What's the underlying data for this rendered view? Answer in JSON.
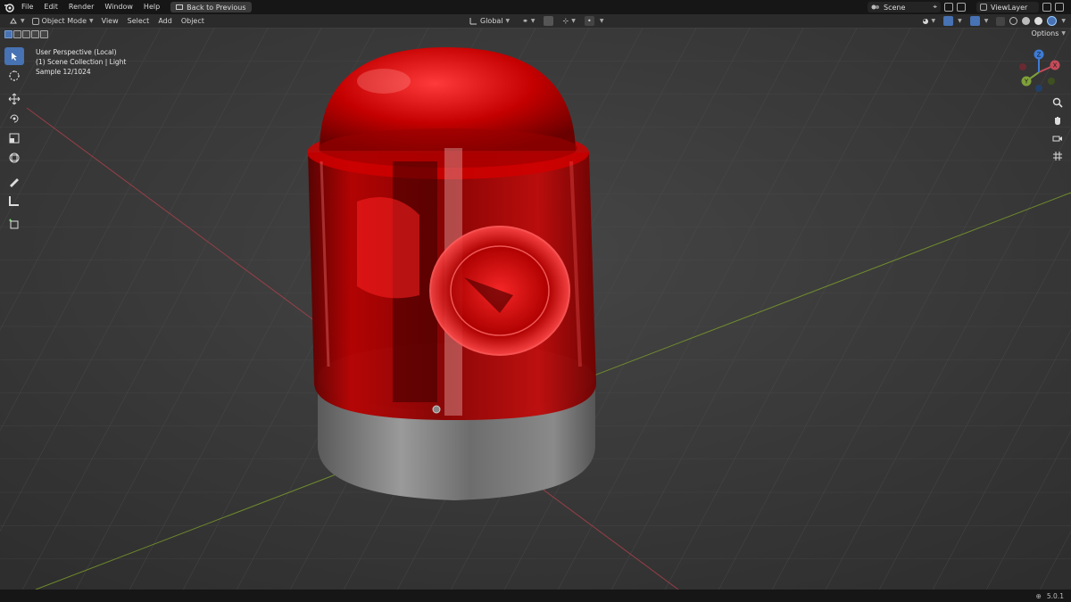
{
  "topbar": {
    "menus": [
      "File",
      "Edit",
      "Render",
      "Window",
      "Help"
    ],
    "back_button": "Back to Previous",
    "scene_name": "Scene",
    "view_layer": "ViewLayer"
  },
  "header": {
    "mode": "Object Mode",
    "menus": [
      "View",
      "Select",
      "Add",
      "Object"
    ],
    "orientation": "Global",
    "options": "Options"
  },
  "viewport": {
    "perspective": "User Perspective (Local)",
    "collection": "(1) Scene Collection | Light",
    "sample": "Sample 12/1024"
  },
  "gizmo": {
    "x_label": "X",
    "y_label": "Y",
    "z_label": "Z"
  },
  "status": {
    "version": "5.0.1"
  },
  "colors": {
    "accent": "#4772b3",
    "x_axis": "#c54b5a",
    "y_axis": "#7fa03a",
    "z_axis": "#3d7bd6"
  },
  "icons": {
    "toolbar": [
      "select-box-icon",
      "cursor-icon",
      "move-icon",
      "rotate-icon",
      "scale-icon",
      "transform-icon",
      "annotate-icon",
      "measure-icon",
      "add-cube-icon"
    ],
    "nav": [
      "zoom-icon",
      "pan-icon",
      "camera-icon",
      "grid-icon"
    ]
  }
}
